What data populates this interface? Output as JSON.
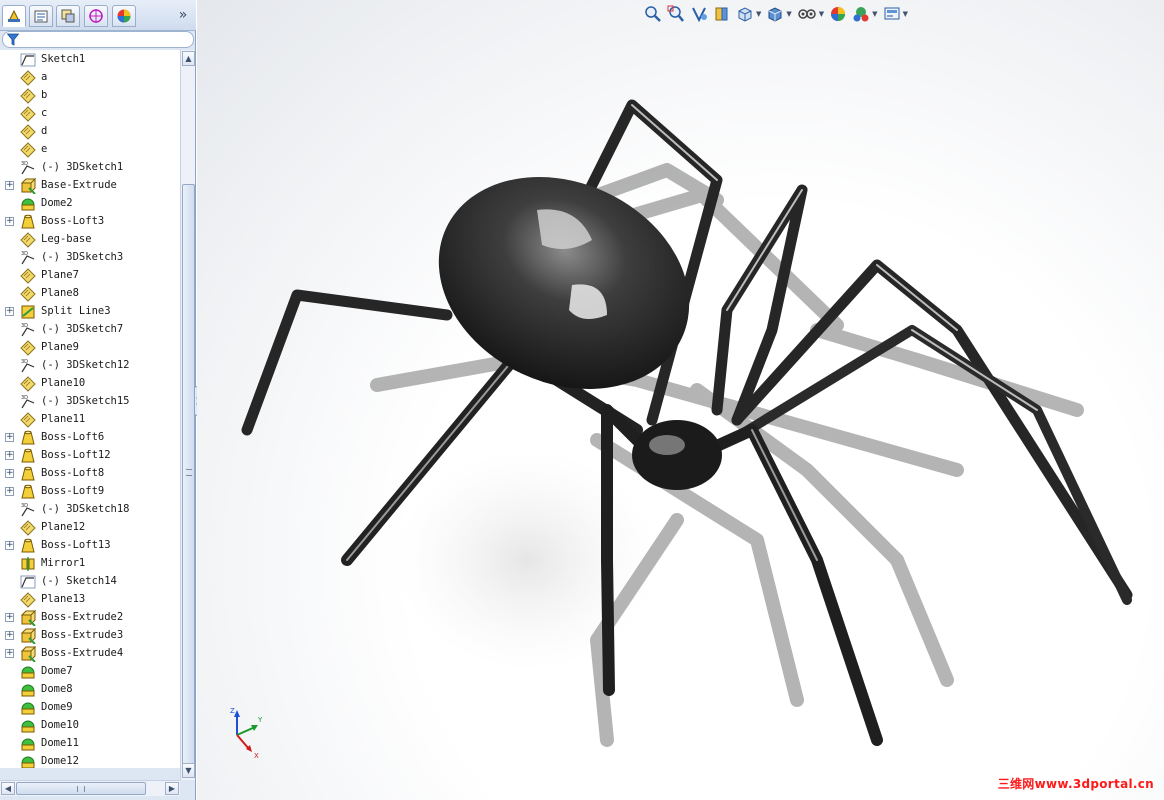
{
  "feature_tree": {
    "items": [
      {
        "label": "Sketch1",
        "icon": "sketch-icon",
        "expandable": false
      },
      {
        "label": "a",
        "icon": "plane-icon",
        "expandable": false
      },
      {
        "label": "b",
        "icon": "plane-icon",
        "expandable": false
      },
      {
        "label": "c",
        "icon": "plane-icon",
        "expandable": false
      },
      {
        "label": "d",
        "icon": "plane-icon",
        "expandable": false
      },
      {
        "label": "e",
        "icon": "plane-icon",
        "expandable": false
      },
      {
        "label": "(-) 3DSketch1",
        "icon": "3dsketch-icon",
        "expandable": false
      },
      {
        "label": "Base-Extrude",
        "icon": "extrude-icon",
        "expandable": true
      },
      {
        "label": "Dome2",
        "icon": "dome-icon",
        "expandable": false
      },
      {
        "label": "Boss-Loft3",
        "icon": "loft-icon",
        "expandable": true
      },
      {
        "label": "Leg-base",
        "icon": "plane-icon",
        "expandable": false
      },
      {
        "label": "(-) 3DSketch3",
        "icon": "3dsketch-icon",
        "expandable": false
      },
      {
        "label": "Plane7",
        "icon": "plane-icon",
        "expandable": false
      },
      {
        "label": "Plane8",
        "icon": "plane-icon",
        "expandable": false
      },
      {
        "label": "Split Line3",
        "icon": "split-line-icon",
        "expandable": true
      },
      {
        "label": "(-) 3DSketch7",
        "icon": "3dsketch-icon",
        "expandable": false
      },
      {
        "label": "Plane9",
        "icon": "plane-icon",
        "expandable": false
      },
      {
        "label": "(-) 3DSketch12",
        "icon": "3dsketch-icon",
        "expandable": false
      },
      {
        "label": "Plane10",
        "icon": "plane-icon",
        "expandable": false
      },
      {
        "label": "(-) 3DSketch15",
        "icon": "3dsketch-icon",
        "expandable": false
      },
      {
        "label": "Plane11",
        "icon": "plane-icon",
        "expandable": false
      },
      {
        "label": "Boss-Loft6",
        "icon": "loft-icon",
        "expandable": true
      },
      {
        "label": "Boss-Loft12",
        "icon": "loft-icon",
        "expandable": true
      },
      {
        "label": "Boss-Loft8",
        "icon": "loft-icon",
        "expandable": true
      },
      {
        "label": "Boss-Loft9",
        "icon": "loft-icon",
        "expandable": true
      },
      {
        "label": "(-) 3DSketch18",
        "icon": "3dsketch-icon",
        "expandable": false
      },
      {
        "label": "Plane12",
        "icon": "plane-icon",
        "expandable": false
      },
      {
        "label": "Boss-Loft13",
        "icon": "loft-icon",
        "expandable": true
      },
      {
        "label": "Mirror1",
        "icon": "mirror-icon",
        "expandable": false
      },
      {
        "label": "(-) Sketch14",
        "icon": "sketch-icon",
        "expandable": false
      },
      {
        "label": "Plane13",
        "icon": "plane-icon",
        "expandable": false
      },
      {
        "label": "Boss-Extrude2",
        "icon": "extrude-icon",
        "expandable": true
      },
      {
        "label": "Boss-Extrude3",
        "icon": "extrude-icon",
        "expandable": true
      },
      {
        "label": "Boss-Extrude4",
        "icon": "extrude-icon",
        "expandable": true
      },
      {
        "label": "Dome7",
        "icon": "dome-icon",
        "expandable": false
      },
      {
        "label": "Dome8",
        "icon": "dome-icon",
        "expandable": false
      },
      {
        "label": "Dome9",
        "icon": "dome-icon",
        "expandable": false
      },
      {
        "label": "Dome10",
        "icon": "dome-icon",
        "expandable": false
      },
      {
        "label": "Dome11",
        "icon": "dome-icon",
        "expandable": false
      },
      {
        "label": "Dome12",
        "icon": "dome-icon",
        "expandable": false
      }
    ]
  },
  "panel_tabs": [
    "feature-manager-icon",
    "property-manager-icon",
    "configuration-manager-icon",
    "dimxpert-icon",
    "display-manager-icon"
  ],
  "panel_expand_glyph": "»",
  "heads_up_toolbar": [
    "zoom-to-fit-icon",
    "zoom-to-area-icon",
    "previous-view-icon",
    "section-view-icon",
    "view-orientation-icon",
    "display-style-icon",
    "hide-show-items-icon",
    "edit-appearance-icon",
    "apply-scene-icon",
    "view-settings-icon"
  ],
  "watermark": "三维网www.3dportal.cn",
  "triad": {
    "x_label": "X",
    "y_label": "Y",
    "z_label": "Z"
  },
  "colors": {
    "panel_bg": "#dde7f3",
    "tree_bg": "#ffffff",
    "accent": "#2c5fa8",
    "watermark": "#ff1a1a",
    "spider": "#1e1e1e"
  }
}
